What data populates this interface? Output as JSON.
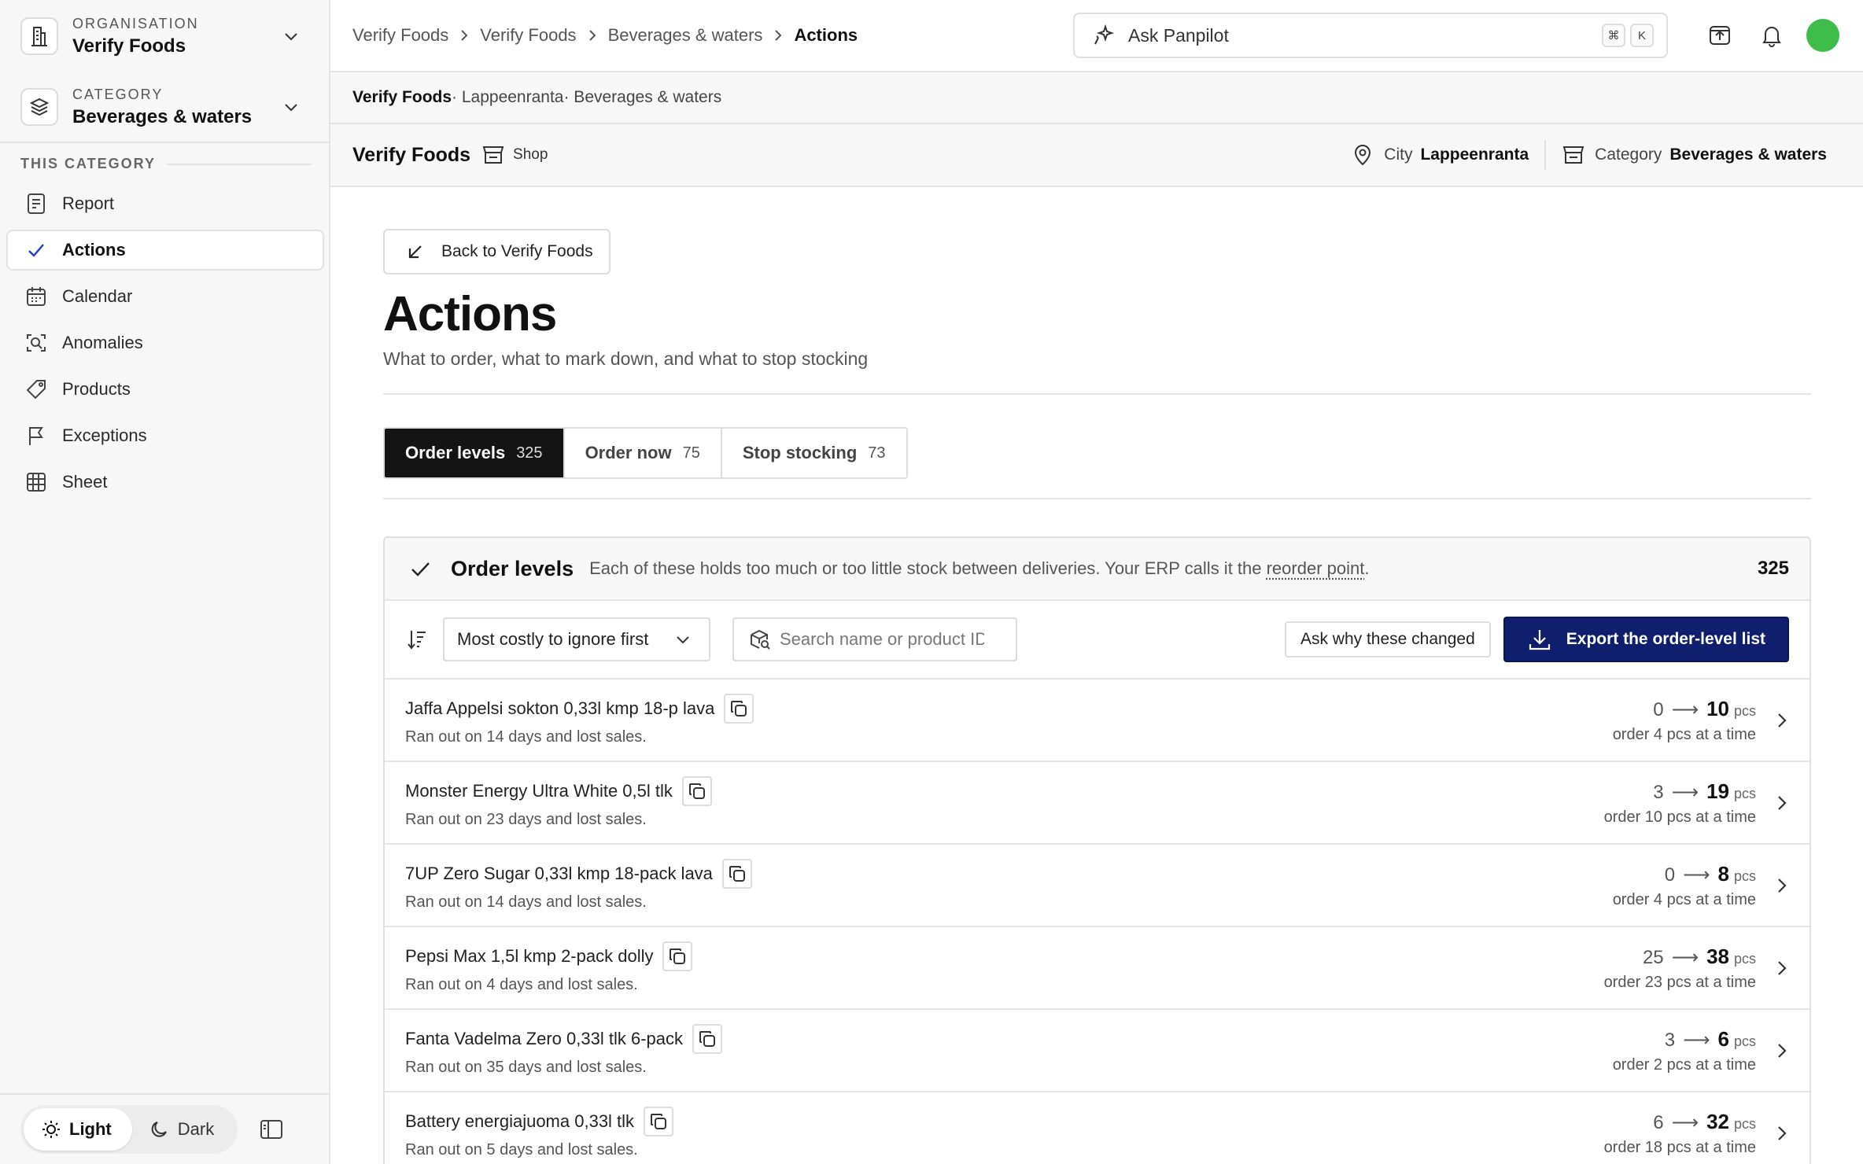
{
  "sidebar": {
    "org": {
      "label": "ORGANISATION",
      "value": "Verify Foods"
    },
    "category": {
      "label": "CATEGORY",
      "value": "Beverages & waters"
    },
    "section_title": "THIS CATEGORY",
    "items": [
      {
        "label": "Report",
        "icon": "report-icon"
      },
      {
        "label": "Actions",
        "icon": "check-icon",
        "active": true
      },
      {
        "label": "Calendar",
        "icon": "calendar-icon"
      },
      {
        "label": "Anomalies",
        "icon": "anomalies-icon"
      },
      {
        "label": "Products",
        "icon": "tag-icon"
      },
      {
        "label": "Exceptions",
        "icon": "flag-icon"
      },
      {
        "label": "Sheet",
        "icon": "grid-icon"
      }
    ],
    "theme": {
      "light": "Light",
      "dark": "Dark"
    }
  },
  "topbar": {
    "breadcrumbs": [
      "Verify Foods",
      "Verify Foods",
      "Beverages & waters",
      "Actions"
    ],
    "ask": {
      "label": "Ask Panpilot",
      "kbd1": "⌘",
      "kbd2": "K"
    },
    "avatar_color": "#3ebd4b"
  },
  "context": {
    "org": "Verify Foods",
    "rest": "· Lappeenranta· Beverages & waters"
  },
  "entity": {
    "name": "Verify Foods",
    "type": "Shop",
    "city_label": "City",
    "city": "Lappeenranta",
    "category_label": "Category",
    "category": "Beverages & waters"
  },
  "main": {
    "back": "Back to Verify Foods",
    "title": "Actions",
    "subtitle": "What to order, what to mark down, and what to stop stocking",
    "tabs": [
      {
        "label": "Order levels",
        "count": "325",
        "active": true
      },
      {
        "label": "Order now",
        "count": "75"
      },
      {
        "label": "Stop stocking",
        "count": "73"
      }
    ]
  },
  "panel": {
    "title": "Order levels",
    "desc_pre": "Each of these holds too much or too little stock between deliveries. Your ERP calls it the ",
    "desc_link": "reorder point",
    "desc_post": ".",
    "total": "325",
    "sort": "Most costly to ignore first",
    "search_placeholder": "Search name or product ID",
    "why": "Ask why these changed",
    "export": "Export the order-level list",
    "accent": "#0f1f6e"
  },
  "rows": [
    {
      "name": "Jaffa Appelsi sokton 0,33l kmp 18-p lava",
      "note": "Ran out on 14 days and lost sales.",
      "from": "0",
      "arrow": "⟶",
      "to": "10",
      "unit": "pcs",
      "order": "order 4 pcs at a time"
    },
    {
      "name": "Monster Energy Ultra White 0,5l tlk",
      "note": "Ran out on 23 days and lost sales.",
      "from": "3",
      "arrow": "⟶",
      "to": "19",
      "unit": "pcs",
      "order": "order 10 pcs at a time"
    },
    {
      "name": "7UP Zero Sugar 0,33l kmp 18-pack lava",
      "note": "Ran out on 14 days and lost sales.",
      "from": "0",
      "arrow": "⟶",
      "to": "8",
      "unit": "pcs",
      "order": "order 4 pcs at a time"
    },
    {
      "name": "Pepsi Max 1,5l kmp 2-pack dolly",
      "note": "Ran out on 4 days and lost sales.",
      "from": "25",
      "arrow": "⟶",
      "to": "38",
      "unit": "pcs",
      "order": "order 23 pcs at a time"
    },
    {
      "name": "Fanta Vadelma Zero 0,33l tlk 6-pack",
      "note": "Ran out on 35 days and lost sales.",
      "from": "3",
      "arrow": "⟶",
      "to": "6",
      "unit": "pcs",
      "order": "order 2 pcs at a time"
    },
    {
      "name": "Battery energiajuoma 0,33l tlk",
      "note": "Ran out on 5 days and lost sales.",
      "from": "6",
      "arrow": "⟶",
      "to": "32",
      "unit": "pcs",
      "order": "order 18 pcs at a time"
    }
  ]
}
